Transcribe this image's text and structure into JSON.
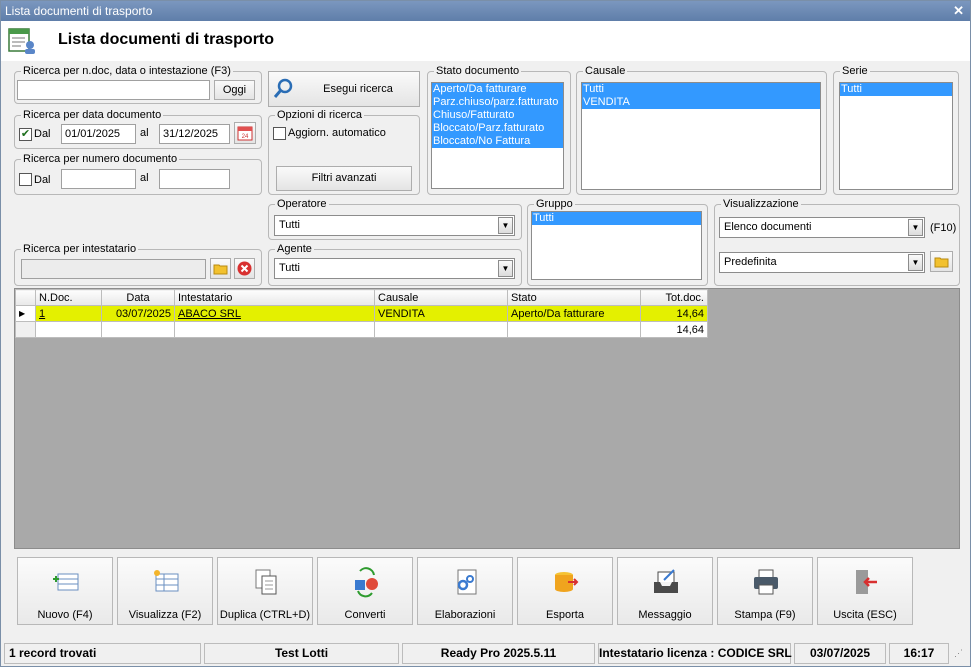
{
  "window": {
    "title": "Lista documenti di trasporto"
  },
  "header": {
    "title": "Lista documenti di trasporto"
  },
  "search_ndoc": {
    "legend": "Ricerca per n.doc, data o intestazione (F3)",
    "value": "",
    "ok_label": "Oggi"
  },
  "search_date": {
    "legend": "Ricerca per data documento",
    "dal_checked": true,
    "dal_label": "Dal",
    "from": "01/01/2025",
    "al_label": "al",
    "to": "31/12/2025"
  },
  "search_number": {
    "legend": "Ricerca per numero documento",
    "dal_checked": false,
    "dal_label": "Dal",
    "from": "",
    "al_label": "al",
    "to": ""
  },
  "search_holder": {
    "legend": "Ricerca per intestatario",
    "value": ""
  },
  "esegui": {
    "label": "Esegui ricerca"
  },
  "options": {
    "legend": "Opzioni di ricerca",
    "auto_label": "Aggiorn. automatico",
    "auto_checked": false,
    "filters_label": "Filtri avanzati"
  },
  "stato": {
    "legend": "Stato documento",
    "items": [
      "Aperto/Da fatturare",
      "Parz.chiuso/parz.fatturato",
      "Chiuso/Fatturato",
      "Bloccato/Parz.fatturato",
      "Bloccato/No Fattura"
    ]
  },
  "causale": {
    "legend": "Causale",
    "items": [
      "Tutti",
      "VENDITA"
    ]
  },
  "serie": {
    "legend": "Serie",
    "items": [
      "Tutti"
    ]
  },
  "operatore": {
    "legend": "Operatore",
    "value": "Tutti"
  },
  "agente": {
    "legend": "Agente",
    "value": "Tutti"
  },
  "gruppo": {
    "legend": "Gruppo",
    "items": [
      "Tutti"
    ]
  },
  "visualizzazione": {
    "legend": "Visualizzazione",
    "value": "Elenco documenti",
    "shortcut": "(F10)",
    "layout": "Predefinita"
  },
  "grid": {
    "columns": [
      "N.Doc.",
      "Data",
      "Intestatario",
      "Causale",
      "Stato",
      "Tot.doc."
    ],
    "rows": [
      {
        "ndoc": "1",
        "data": "03/07/2025",
        "intestatario": "ABACO SRL",
        "causale": "VENDITA",
        "stato": "Aperto/Da fatturare",
        "tot": "14,64"
      }
    ],
    "total": "14,64",
    "highlight_color": "#e4f000"
  },
  "toolbar": [
    {
      "label": "Nuovo (F4)",
      "icon": "new-icon"
    },
    {
      "label": "Visualizza (F2)",
      "icon": "view-icon"
    },
    {
      "label": "Duplica (CTRL+D)",
      "icon": "duplicate-icon"
    },
    {
      "label": "Converti",
      "icon": "convert-icon"
    },
    {
      "label": "Elaborazioni",
      "icon": "process-icon"
    },
    {
      "label": "Esporta",
      "icon": "export-icon"
    },
    {
      "label": "Messaggio",
      "icon": "message-icon"
    },
    {
      "label": "Stampa (F9)",
      "icon": "print-icon"
    },
    {
      "label": "Uscita (ESC)",
      "icon": "exit-icon"
    }
  ],
  "status": {
    "records": "1 record trovati",
    "user": "Test Lotti",
    "version": "Ready Pro 2025.5.11",
    "license": "Intestatario licenza : CODICE SRL",
    "date": "03/07/2025",
    "time": "16:17"
  }
}
